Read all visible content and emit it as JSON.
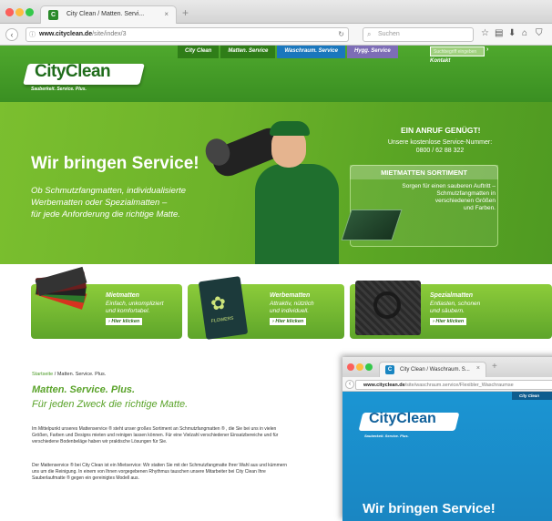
{
  "browser1": {
    "tab_title": "City Clean / Matten. Servi...",
    "tab_close": "×",
    "new_tab": "+",
    "url_domain": "www.cityclean.de",
    "url_path": "/site/index/3",
    "search_placeholder": "Suchen",
    "toolbar_icons": [
      "reload-icon",
      "star-icon",
      "bookmark-icon",
      "download-icon",
      "home-icon",
      "shield-icon",
      "menu-icon"
    ]
  },
  "site": {
    "menu": [
      "City Clean",
      "Matten. Service",
      "Waschraum. Service",
      "Hygg. Service"
    ],
    "search_placeholder": "Suchbegriff eingeben",
    "kontakt": "Kontakt",
    "logo_text": "CityClean",
    "logo_tm": "®",
    "tagline": "Sauberkeit. Service. Plus.",
    "hero": {
      "title": "Wir bringen Service!",
      "subtitle_lines": [
        "Ob Schmutzfangmatten, individualisierte",
        "Werbematten oder Spezialmatten –",
        "für jede Anforderung die richtige Matte."
      ],
      "call_heading": "EIN ANRUF GENÜGT!",
      "call_line1": "Unsere kostenlose Service-Nummer:",
      "call_number": "0800 / 62 88 322",
      "box_heading": "MIETMATTEN SORTIMENT",
      "box_lines": [
        "Sorgen für einen sauberen Auftritt –",
        "Schmutzfangmatten in",
        "verschiedenen Größen",
        "und Farben."
      ]
    },
    "products": [
      {
        "title": "Mietmatten",
        "lines": [
          "Einfach, unkompliziert",
          "und komfortabel."
        ],
        "button": "› Hier klicken"
      },
      {
        "title": "Werbematten",
        "lines": [
          "Attraktiv, nützlich",
          "und individuell."
        ],
        "button": "› Hier klicken"
      },
      {
        "title": "Spezialmatten",
        "lines": [
          "Entlasten, schonen",
          "und säubern."
        ],
        "button": "› Hier klicken"
      }
    ],
    "flowers_label": "FLOWERS",
    "breadcrumb_link": "Startseite",
    "breadcrumb_current": " / Matten. Service. Plus.",
    "heading1": "Matten. Service. Plus.",
    "heading2": "Für jeden Zweck die richtige Matte.",
    "paragraphs": [
      [
        "Im Mittelpunkt unseres Mattenservice ® steht unser großes Sortiment an Schmutzfangmatten ® , die Sie bei uns in vielen",
        "Größen, Farben und Designs mieten und reinigen lassen können. Für eine Vielzahl verschiedener Einsatzbereiche und für",
        "verschiedene Bodenbeläge haben wir praktische Lösungen für Sie."
      ],
      [
        "Der Mattenservice ® bei City Clean ist ein Mietservice: Wir statten Sie mit der Schmutzfangmatte Ihrer Wahl aus und kümmern",
        "uns um die Reinigung. In einem von Ihnen vorgegebenen Rhythmus tauschen unsere Mitarbeiter bei City Clean Ihre",
        "Sauberlaufmatte ® gegen ein gereinigtes Modell aus."
      ]
    ]
  },
  "browser2": {
    "tab_title": "City Clean / Waschraum. S...",
    "tab_close": "×",
    "new_tab": "+",
    "url_domain": "www.cityclean.de",
    "url_path": "/site/waschraum.service/Flexibler_Waschraumse",
    "menu_item": "City Clean",
    "logo_text": "CityClean",
    "tagline": "Sauberkeit. Service. Plus.",
    "hero_title": "Wir bringen Service!"
  },
  "colors": {
    "brand_green": "#5aa32a",
    "header_green": "#3a8f22",
    "menu_active": "#7d6db6",
    "blue_theme": "#1b95d3"
  }
}
